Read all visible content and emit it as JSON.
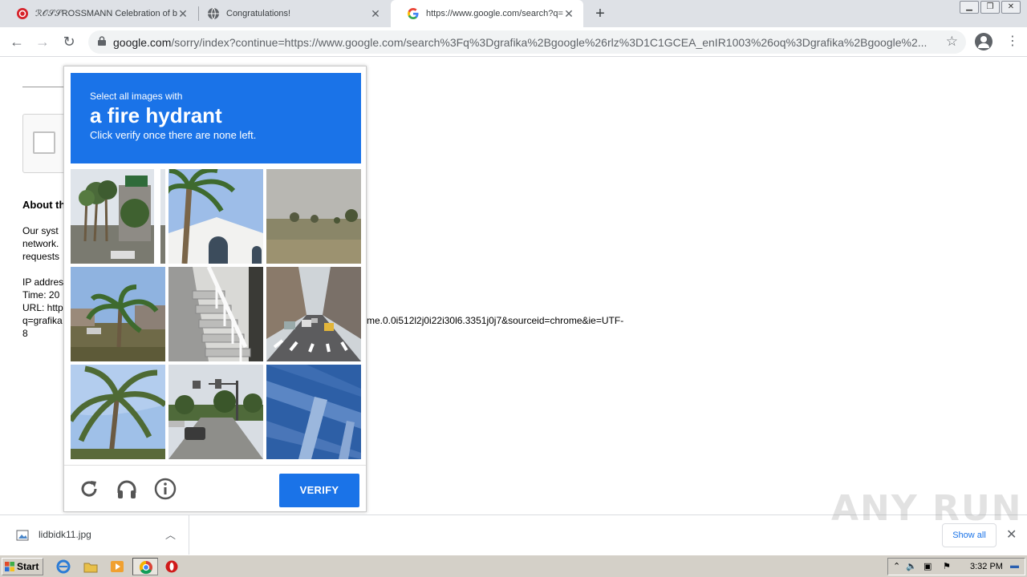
{
  "browser": {
    "tabs": [
      {
        "title": "ℛ𝒪𝒮𝒮ROSSMANN Celebration of b",
        "active": false
      },
      {
        "title": "Congratulations!",
        "active": false
      },
      {
        "title": "https://www.google.com/search?q=",
        "active": true
      }
    ],
    "tab_close_glyph": "✕",
    "new_tab_glyph": "+",
    "url_host": "google.com",
    "url_rest": "/sorry/index?continue=https://www.google.com/search%3Fq%3Dgrafika%2Bgoogle%26rlz%3D1C1GCEA_enIR1003%26oq%3Dgrafika%2Bgoogle%2..."
  },
  "page": {
    "about_heading": "About th",
    "paragraph_lines": [
      "Our syst",
      "network.",
      "requests"
    ],
    "ip_lines": [
      "IP addres",
      "Time: 20",
      "URL: http",
      "q=grafika",
      "8"
    ],
    "url_tail": "me.0.0i512l2j0i22i30l6.3351j0j7&sourceid=chrome&ie=UTF-"
  },
  "captcha": {
    "select_text": "Select all images with",
    "object_text": "a fire hydrant",
    "instruction_text": "Click verify once there are none left.",
    "verify_label": "VERIFY",
    "header_color": "#1a73e8",
    "tiles": [
      "palm-trees-sign",
      "palm-white-building",
      "field-trees",
      "palm-road",
      "stairs-railing",
      "city-street-cars",
      "palm-fronds",
      "road-traffic-light",
      "blue-structure"
    ]
  },
  "downloads": {
    "file_name": "lidbidk11.jpg",
    "show_all_label": "Show all"
  },
  "watermark": "ANY RUN",
  "taskbar": {
    "start_label": "Start",
    "clock": "3:32 PM"
  }
}
